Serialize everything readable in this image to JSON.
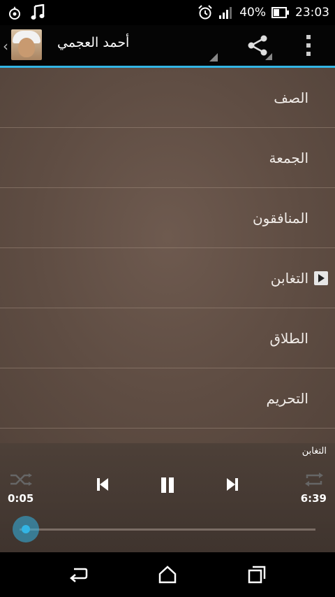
{
  "status_bar": {
    "battery_percent": "40%",
    "time": "23:03",
    "icons": [
      "notification-icon",
      "music-note-icon",
      "alarm-icon",
      "signal-icon",
      "battery-icon"
    ]
  },
  "action_bar": {
    "title": "أحمد العجمي",
    "icons": [
      "back-caret-icon",
      "avatar",
      "share-icon",
      "overflow-menu-icon"
    ]
  },
  "list": {
    "items": [
      {
        "label": "الصف",
        "playing": false
      },
      {
        "label": "الجمعة",
        "playing": false
      },
      {
        "label": "المنافقون",
        "playing": false
      },
      {
        "label": "التغابن",
        "playing": true
      },
      {
        "label": "الطلاق",
        "playing": false
      },
      {
        "label": "التحريم",
        "playing": false
      }
    ]
  },
  "player": {
    "now_playing": "التغابن",
    "elapsed": "0:05",
    "duration": "6:39",
    "progress": 0.0125,
    "controls": [
      "shuffle-icon",
      "previous-icon",
      "pause-icon",
      "next-icon",
      "repeat-icon"
    ]
  },
  "nav_bar": {
    "buttons": [
      "back-icon",
      "home-icon",
      "recents-icon"
    ]
  },
  "colors": {
    "accent": "#33b5e5",
    "list_background": "#5f4d43",
    "player_background": "#463a33"
  }
}
